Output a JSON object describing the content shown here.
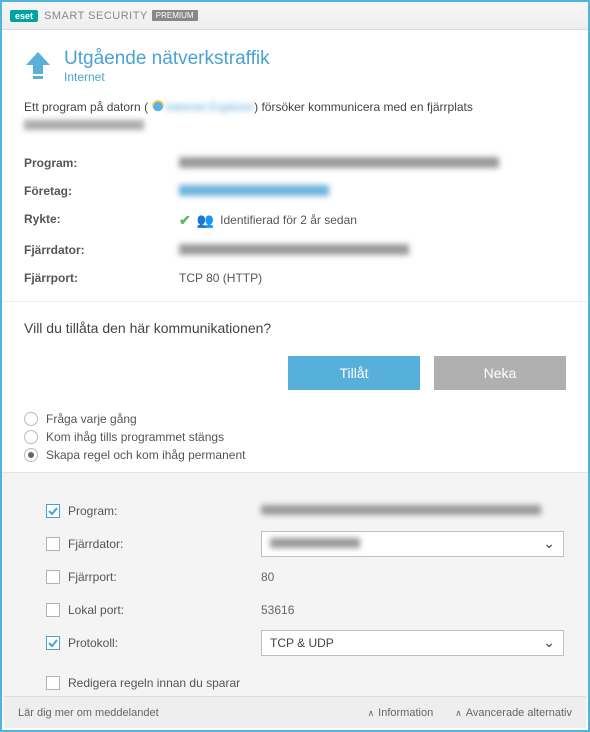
{
  "header": {
    "product": "SMART SECURITY",
    "badge": "eset",
    "edition": "PREMIUM"
  },
  "title": {
    "main": "Utgående nätverkstraffik",
    "sub": "Internet"
  },
  "intro": {
    "prefix": "Ett program på datorn (",
    "appname": "Internet Explorer",
    "suffix": ") försöker kommunicera med en fjärrplats"
  },
  "info": {
    "program_label": "Program:",
    "program_value": "",
    "company_label": "Företag:",
    "company_value": "",
    "reputation_label": "Rykte:",
    "reputation_text": "Identifierad för 2 år sedan",
    "remote_label": "Fjärrdator:",
    "remote_value": "",
    "port_label": "Fjärrport:",
    "port_value": "TCP 80 (HTTP)"
  },
  "question": "Vill du tillåta den här kommunikationen?",
  "buttons": {
    "allow": "Tillåt",
    "deny": "Neka"
  },
  "radios": {
    "ask": "Fråga varje gång",
    "remember_session": "Kom ihåg tills programmet stängs",
    "create_rule": "Skapa regel och kom ihåg permanent",
    "selected": "create_rule"
  },
  "rule": {
    "program": {
      "label": "Program:",
      "checked": true,
      "value": ""
    },
    "remote": {
      "label": "Fjärrdator:",
      "checked": false,
      "value": ""
    },
    "remote_port": {
      "label": "Fjärrport:",
      "checked": false,
      "value": "80"
    },
    "local_port": {
      "label": "Lokal port:",
      "checked": false,
      "value": "53616"
    },
    "protocol": {
      "label": "Protokoll:",
      "checked": true,
      "value": "TCP & UDP"
    },
    "edit_before_save": {
      "label": "Redigera regeln innan du sparar",
      "checked": false
    }
  },
  "footer": {
    "learn": "Lär dig mer om meddelandet",
    "info": "Information",
    "advanced": "Avancerade alternativ"
  }
}
